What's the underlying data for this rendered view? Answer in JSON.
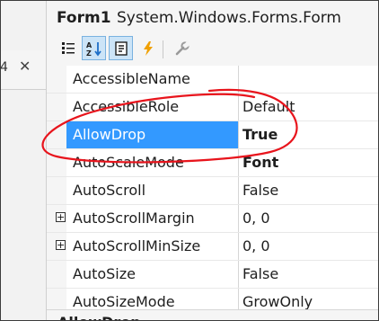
{
  "left_panel": {
    "tab_label": "4",
    "close_glyph": "✕"
  },
  "properties": {
    "object_name": "Form1",
    "object_type": "System.Windows.Forms.Form",
    "toolbar": {
      "buttons": [
        {
          "name": "categorized-icon"
        },
        {
          "name": "alphabetical-icon",
          "active": true
        },
        {
          "name": "properties-icon",
          "active": true
        },
        {
          "name": "events-icon"
        },
        {
          "name": "property-pages-icon"
        }
      ]
    },
    "rows": [
      {
        "name": "AccessibleName",
        "value": ""
      },
      {
        "name": "AccessibleRole",
        "value": "Default"
      },
      {
        "name": "AllowDrop",
        "value": "True",
        "bold": true,
        "selected": true
      },
      {
        "name": "AutoScaleMode",
        "value": "Font",
        "bold": true
      },
      {
        "name": "AutoScroll",
        "value": "False"
      },
      {
        "name": "AutoScrollMargin",
        "value": "0, 0",
        "expandable": true
      },
      {
        "name": "AutoScrollMinSize",
        "value": "0, 0",
        "expandable": true
      },
      {
        "name": "AutoSize",
        "value": "False"
      },
      {
        "name": "AutoSizeMode",
        "value": "GrowOnly"
      }
    ],
    "description_title": "AllowDrop"
  },
  "colors": {
    "selection": "#3399ff",
    "annotation": "#e8141c",
    "toolbar_active": "#cce4f7"
  }
}
